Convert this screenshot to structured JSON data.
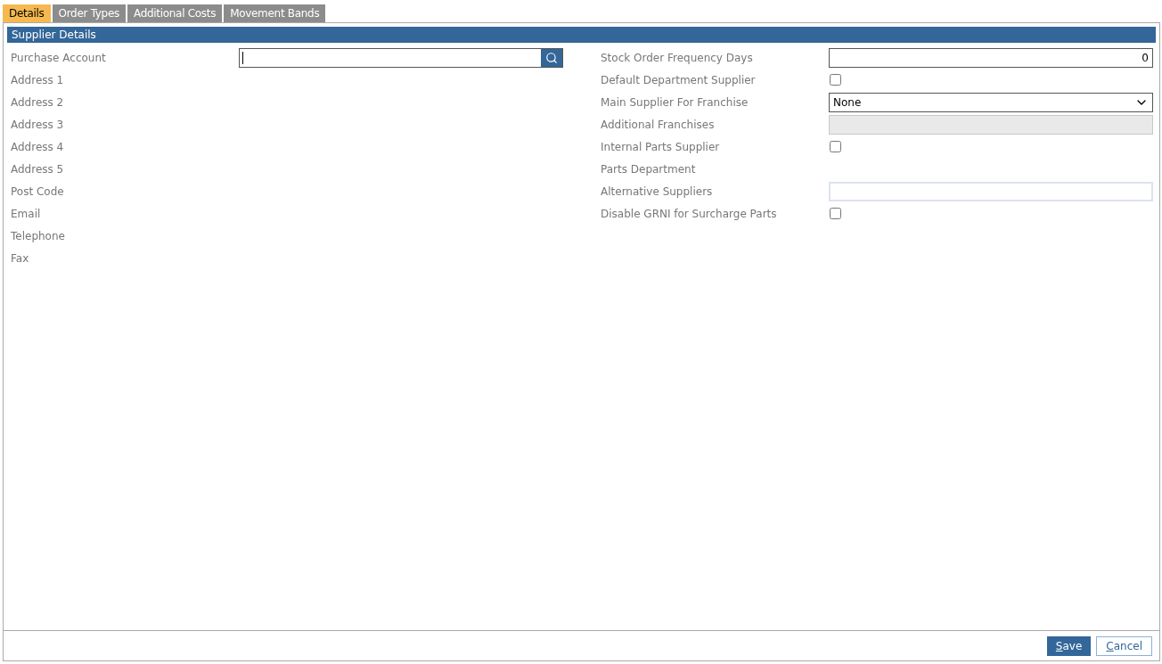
{
  "tabs": [
    {
      "label": "Details",
      "selected": true
    },
    {
      "label": "Order Types",
      "selected": false
    },
    {
      "label": "Additional Costs",
      "selected": false
    },
    {
      "label": "Movement Bands",
      "selected": false
    }
  ],
  "section": {
    "title": "Supplier Details"
  },
  "left_fields": [
    {
      "label": "Purchase Account",
      "kind": "lookup"
    },
    {
      "label": "Address 1",
      "kind": "static"
    },
    {
      "label": "Address 2",
      "kind": "static"
    },
    {
      "label": "Address 3",
      "kind": "static"
    },
    {
      "label": "Address 4",
      "kind": "static"
    },
    {
      "label": "Address 5",
      "kind": "static"
    },
    {
      "label": "Post Code",
      "kind": "static"
    },
    {
      "label": "Email",
      "kind": "static"
    },
    {
      "label": "Telephone",
      "kind": "static"
    },
    {
      "label": "Fax",
      "kind": "static"
    }
  ],
  "right_fields": [
    {
      "label": "Stock Order Frequency Days",
      "kind": "number",
      "value": "0"
    },
    {
      "label": "Default Department Supplier",
      "kind": "checkbox",
      "checked": false
    },
    {
      "label": "Main Supplier For Franchise",
      "kind": "select",
      "value": "None"
    },
    {
      "label": "Additional Franchises",
      "kind": "text",
      "disabled": true
    },
    {
      "label": "Internal Parts Supplier",
      "kind": "checkbox",
      "checked": false
    },
    {
      "label": "Parts Department",
      "kind": "static"
    },
    {
      "label": "Alternative Suppliers",
      "kind": "text",
      "disabled": false
    },
    {
      "label": "Disable GRNI for Surcharge Parts",
      "kind": "checkbox",
      "checked": false
    }
  ],
  "buttons": [
    {
      "label": "Save",
      "kind": "primary"
    },
    {
      "label": "Cancel",
      "kind": "secondary"
    }
  ]
}
